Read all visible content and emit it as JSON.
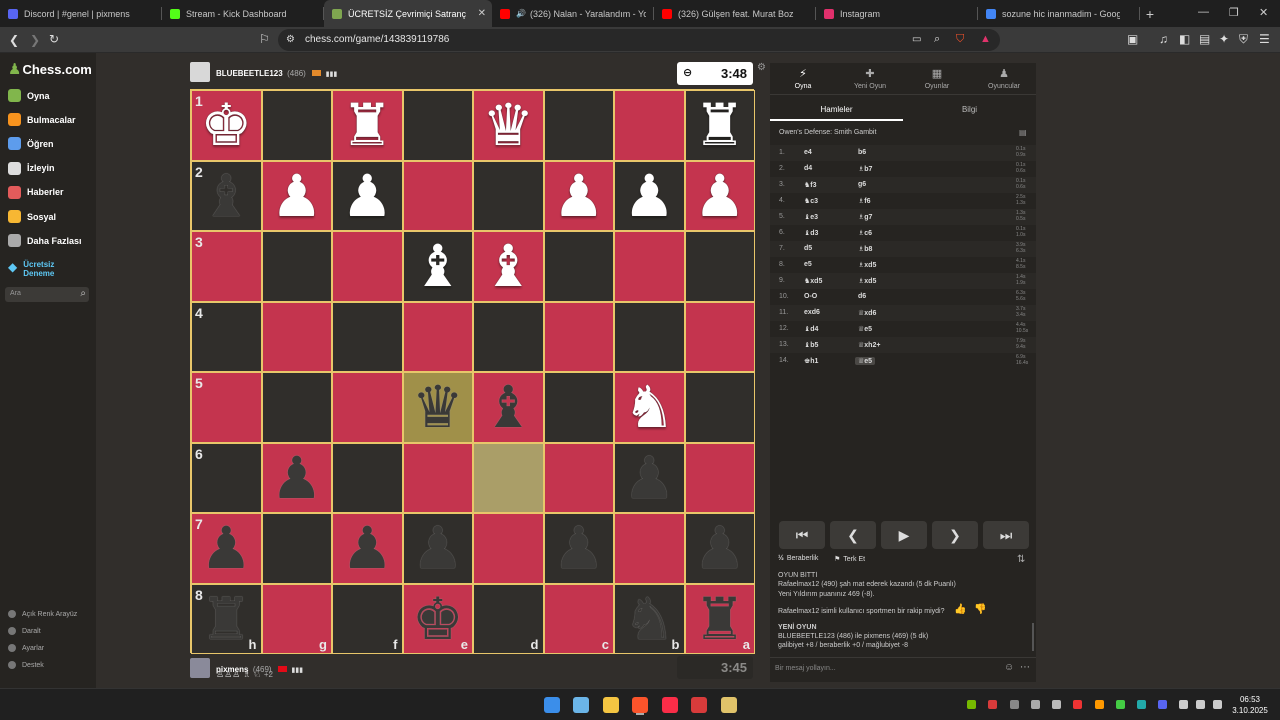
{
  "browser": {
    "tabs": [
      {
        "title": "Discord | #genel | pixmens",
        "color": "#5865f2",
        "active": false,
        "playing": false
      },
      {
        "title": "Stream - Kick Dashboard",
        "color": "#53fc18",
        "active": false,
        "playing": false
      },
      {
        "title": "ÜCRETSİZ Çevrimiçi Satranç Oyna",
        "color": "#7fa650",
        "active": true,
        "playing": false
      },
      {
        "title": "(326) Nalan - Yaralandım - YouTube",
        "color": "#ff0000",
        "active": false,
        "playing": true
      },
      {
        "title": "(326) Gülşen feat. Murat Boz - İltimas",
        "color": "#ff0000",
        "active": false,
        "playing": false
      },
      {
        "title": "Instagram",
        "color": "#e1306c",
        "active": false,
        "playing": false
      },
      {
        "title": "sozune hic inanmadim - Google'da Ara",
        "color": "#4285f4",
        "active": false,
        "playing": false
      }
    ],
    "url": "chess.com/game/143839119786"
  },
  "leftnav": {
    "logo": "Chess.com",
    "items": [
      {
        "label": "Oyna",
        "color": "#81b64c"
      },
      {
        "label": "Bulmacalar",
        "color": "#f7931e"
      },
      {
        "label": "Öğren",
        "color": "#5d9cec"
      },
      {
        "label": "İzleyin",
        "color": "#ddd"
      },
      {
        "label": "Haberler",
        "color": "#e35b5b"
      },
      {
        "label": "Sosyal",
        "color": "#f7b733"
      },
      {
        "label": "Daha Fazlası",
        "color": "#aaa"
      }
    ],
    "trial": "Ücretsiz Deneme",
    "search_placeholder": "Ara",
    "footer": [
      "Açık Renk Arayüz",
      "Daralt",
      "Ayarlar",
      "Destek"
    ]
  },
  "game": {
    "top_player": {
      "name": "BLUEBEETLE123",
      "rating": "(486)",
      "clock": "3:48"
    },
    "bottom_player": {
      "name": "pixmens",
      "rating": "(469)",
      "material": "+2",
      "clock": "3:45"
    },
    "board": [
      [
        {
          "p": "♚",
          "c": "w"
        },
        null,
        {
          "p": "♜",
          "c": "w"
        },
        null,
        {
          "p": "♛",
          "c": "w"
        },
        null,
        null,
        {
          "p": "♜",
          "c": "w"
        }
      ],
      [
        {
          "p": "♝",
          "c": "b"
        },
        {
          "p": "♟",
          "c": "w"
        },
        {
          "p": "♟",
          "c": "w"
        },
        null,
        null,
        {
          "p": "♟",
          "c": "w"
        },
        {
          "p": "♟",
          "c": "w"
        },
        {
          "p": "♟",
          "c": "w"
        }
      ],
      [
        null,
        null,
        null,
        {
          "p": "♝",
          "c": "w"
        },
        {
          "p": "♝",
          "c": "w"
        },
        null,
        null,
        null
      ],
      [
        null,
        null,
        null,
        null,
        null,
        null,
        null,
        null
      ],
      [
        null,
        null,
        null,
        {
          "p": "♛",
          "c": "b"
        },
        {
          "p": "♝",
          "c": "b"
        },
        null,
        {
          "p": "♞",
          "c": "w"
        },
        null
      ],
      [
        null,
        {
          "p": "♟",
          "c": "b"
        },
        null,
        null,
        null,
        null,
        {
          "p": "♟",
          "c": "b"
        },
        null
      ],
      [
        {
          "p": "♟",
          "c": "b"
        },
        null,
        {
          "p": "♟",
          "c": "b"
        },
        {
          "p": "♟",
          "c": "b"
        },
        null,
        {
          "p": "♟",
          "c": "b"
        },
        null,
        {
          "p": "♟",
          "c": "b"
        }
      ],
      [
        {
          "p": "♜",
          "c": "b"
        },
        null,
        null,
        {
          "p": "♚",
          "c": "b"
        },
        null,
        null,
        {
          "p": "♞",
          "c": "b"
        },
        {
          "p": "♜",
          "c": "b"
        }
      ]
    ],
    "ranks": [
      "1",
      "2",
      "3",
      "4",
      "5",
      "6",
      "7",
      "8"
    ],
    "files": [
      "h",
      "g",
      "f",
      "e",
      "d",
      "c",
      "b",
      "a"
    ]
  },
  "panel": {
    "tabs": [
      {
        "label": "Oyna",
        "icon": "⚡"
      },
      {
        "label": "Yeni Oyun",
        "icon": "✚"
      },
      {
        "label": "Oyunlar",
        "icon": "▦"
      },
      {
        "label": "Oyuncular",
        "icon": "♟"
      }
    ],
    "subtabs": [
      "Hamleler",
      "Bilgi"
    ],
    "opening": "Owen's Defense: Smith Gambit",
    "moves": [
      {
        "n": "1.",
        "w": "e4",
        "b": "b6",
        "tw": "0.1s",
        "tb": "0.9s"
      },
      {
        "n": "2.",
        "w": "d4",
        "b": "♗b7",
        "tw": "0.1s",
        "tb": "0.6s"
      },
      {
        "n": "3.",
        "w": "♞f3",
        "b": "g6",
        "tw": "0.1s",
        "tb": "0.6s"
      },
      {
        "n": "4.",
        "w": "♞c3",
        "b": "♗f6",
        "tw": "2.5s",
        "tb": "1.3s"
      },
      {
        "n": "5.",
        "w": "♝e3",
        "b": "♗g7",
        "tw": "1.3s",
        "tb": "0.5s"
      },
      {
        "n": "6.",
        "w": "♝d3",
        "b": "♗c6",
        "tw": "0.1s",
        "tb": "1.0s"
      },
      {
        "n": "7.",
        "w": "d5",
        "b": "♗b8",
        "tw": "3.9s",
        "tb": "6.3s"
      },
      {
        "n": "8.",
        "w": "e5",
        "b": "♗xd5",
        "tw": "4.1s",
        "tb": "8.5s"
      },
      {
        "n": "9.",
        "w": "♞xd5",
        "b": "♗xd5",
        "tw": "1.4s",
        "tb": "1.9s"
      },
      {
        "n": "10.",
        "w": "O-O",
        "b": "d6",
        "tw": "6.3s",
        "tb": "5.6s"
      },
      {
        "n": "11.",
        "w": "exd6",
        "b": "♕xd6",
        "tw": "3.7s",
        "tb": "3.4s"
      },
      {
        "n": "12.",
        "w": "♝d4",
        "b": "♕e5",
        "tw": "4.4s",
        "tb": "10.5s"
      },
      {
        "n": "13.",
        "w": "♝b5",
        "b": "♕xh2+",
        "tw": "7.9s",
        "tb": "9.4s"
      },
      {
        "n": "14.",
        "w": "♚h1",
        "b": "♕e5",
        "tw": "6.9s",
        "tb": "16.4s"
      }
    ],
    "actions": {
      "draw": "Beraberlik",
      "resign": "Terk Et"
    },
    "chat": {
      "game_over": "OYUN BİTTİ",
      "win_msg": "Rafaelmax12 (490) şah mat ederek kazandı (5 dk Puanlı)",
      "new_rating": "Yeni Yıldırım puanınız 469 (-8).",
      "sportsman": "Rafaelmax12 isimli kullanıcı sportmen bir rakip miydi?",
      "new_game": "YENİ OYUN",
      "new_game_line": "BLUEBEETLE123 (486) ile pixmens (469) (5 dk)",
      "outcomes": "galibiyet +8 / beraberlik +0 / mağlubiyet -8",
      "input_placeholder": "Bir mesaj yollayın..."
    }
  },
  "taskbar": {
    "time": "06:53",
    "date": "3.10.2025"
  }
}
